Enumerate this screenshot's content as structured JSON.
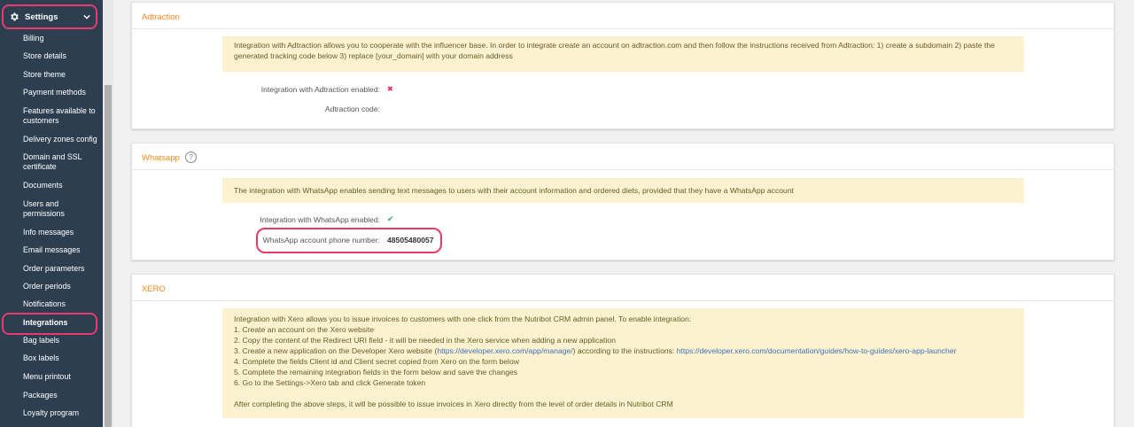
{
  "sidebar": {
    "settings_label": "Settings",
    "items": [
      {
        "label": "Billing"
      },
      {
        "label": "Store details"
      },
      {
        "label": "Store theme"
      },
      {
        "label": "Payment methods"
      },
      {
        "label": "Features available to customers"
      },
      {
        "label": "Delivery zones config"
      },
      {
        "label": "Domain and SSL certificate"
      },
      {
        "label": "Documents"
      },
      {
        "label": "Users and permissions"
      },
      {
        "label": "Info messages"
      },
      {
        "label": "Email messages"
      },
      {
        "label": "Order parameters"
      },
      {
        "label": "Order periods"
      },
      {
        "label": "Notifications"
      },
      {
        "label": "Integrations"
      },
      {
        "label": "Bag labels"
      },
      {
        "label": "Box labels"
      },
      {
        "label": "Menu printout"
      },
      {
        "label": "Packages"
      },
      {
        "label": "Loyalty program"
      }
    ]
  },
  "adtraction": {
    "title": "Adtraction",
    "info": "Integration with Adtraction allows you to cooperate with the influencer base. In order to integrate create an account on adtraction.com and then follow the instructions received from Adtraction: 1) create a subdomain 2) paste the generated tracking code below 3) replace [your_domain] with your domain address",
    "enabled_label": "Integration with Adtraction enabled:",
    "enabled_value": "✖",
    "code_label": "Adtraction code:"
  },
  "whatsapp": {
    "title": "Whatsapp",
    "help": "?",
    "info": "The integration with WhatsApp enables sending text messages to users with their account information and ordered diets, provided that they have a WhatsApp account",
    "enabled_label": "Integration with WhatsApp enabled:",
    "enabled_value": "✔",
    "phone_label": "WhatsApp account phone number:",
    "phone_value": "48505480057"
  },
  "xero": {
    "title": "XERO",
    "intro": "Integration with Xero allows you to issue invoices to customers with one click from the Nutribot CRM admin panel. To enable integration:",
    "step1": "1. Create an account on the Xero website",
    "step2": "2. Copy the content of the Redirect URI field - it will be needed in the Xero service when adding a new application",
    "step3_a": "3. Create a new application on the Developer Xero website (",
    "step3_link1": "https://developer.xero.com/app/manage/",
    "step3_b": ") according to the instructions: ",
    "step3_link2": "https://developer.xero.com/documentation/guides/how-to-guides/xero-app-launcher",
    "step4": "4. Complete the fields Client id and Client secret copied from Xero on the form below",
    "step5": "5. Complete the remaining integration fields in the form below and save the changes",
    "step6": "6. Go to the Settings->Xero tab and click Generate token",
    "outro": "After completing the above steps, it will be possible to issue invoices in Xero directly from the level of order details in Nutribot CRM"
  },
  "colors": {
    "sidebar_bg": "#2c3e50",
    "accent_orange": "#f28a1d",
    "highlight_pink": "#e83a6d",
    "info_bg": "#fcf2cf",
    "link": "#3b73b9",
    "check_green": "#2e9e6b",
    "cross_red": "#e0245e"
  }
}
